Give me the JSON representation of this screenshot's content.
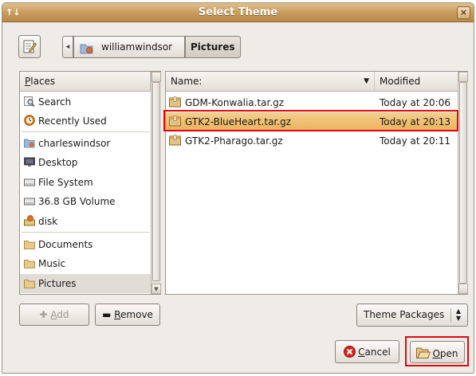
{
  "window": {
    "title": "Select Theme",
    "menu_glyph": "↑↓",
    "close_glyph": "×"
  },
  "pathbar": {
    "home_label": "williamwindsor",
    "current_label": "Pictures",
    "back_glyph": "◂"
  },
  "places": {
    "header_first": "P",
    "header_rest": "laces",
    "items": [
      {
        "label": "Search",
        "icon": "magnifier-icon"
      },
      {
        "label": "Recently Used",
        "icon": "clock-icon"
      },
      {
        "label": "charleswindsor",
        "icon": "home-folder-icon"
      },
      {
        "label": "Desktop",
        "icon": "desktop-icon"
      },
      {
        "label": "File System",
        "icon": "drive-icon"
      },
      {
        "label": "36.8 GB Volume",
        "icon": "drive-icon"
      },
      {
        "label": "disk",
        "icon": "user-disk-icon"
      },
      {
        "label": "Documents",
        "icon": "folder-icon"
      },
      {
        "label": "Music",
        "icon": "folder-icon"
      },
      {
        "label": "Pictures",
        "icon": "folder-icon",
        "selected": true
      }
    ]
  },
  "files": {
    "col_name": "Name:",
    "col_modified": "Modified",
    "sort_glyph": "▼",
    "rows": [
      {
        "name": "GDM-Konwalia.tar.gz",
        "modified": "Today at 20:06"
      },
      {
        "name": "GTK2-BlueHeart.tar.gz",
        "modified": "Today at 20:13",
        "selected": true
      },
      {
        "name": "GTK2-Pharago.tar.gz",
        "modified": "Today at 20:11"
      }
    ]
  },
  "buttons": {
    "add_first": "A",
    "add_rest": "dd",
    "remove_first": "R",
    "remove_rest": "emove",
    "cancel_first": "C",
    "cancel_rest": "ancel",
    "open_first": "O",
    "open_rest": "pen"
  },
  "filter": {
    "selected": "Theme Packages",
    "up": "▲",
    "down": "▼"
  },
  "colors": {
    "titlebar": "#c79a5c",
    "selection": "#eab05a",
    "highlight": "#e3060f",
    "window_bg": "#efebe7"
  }
}
